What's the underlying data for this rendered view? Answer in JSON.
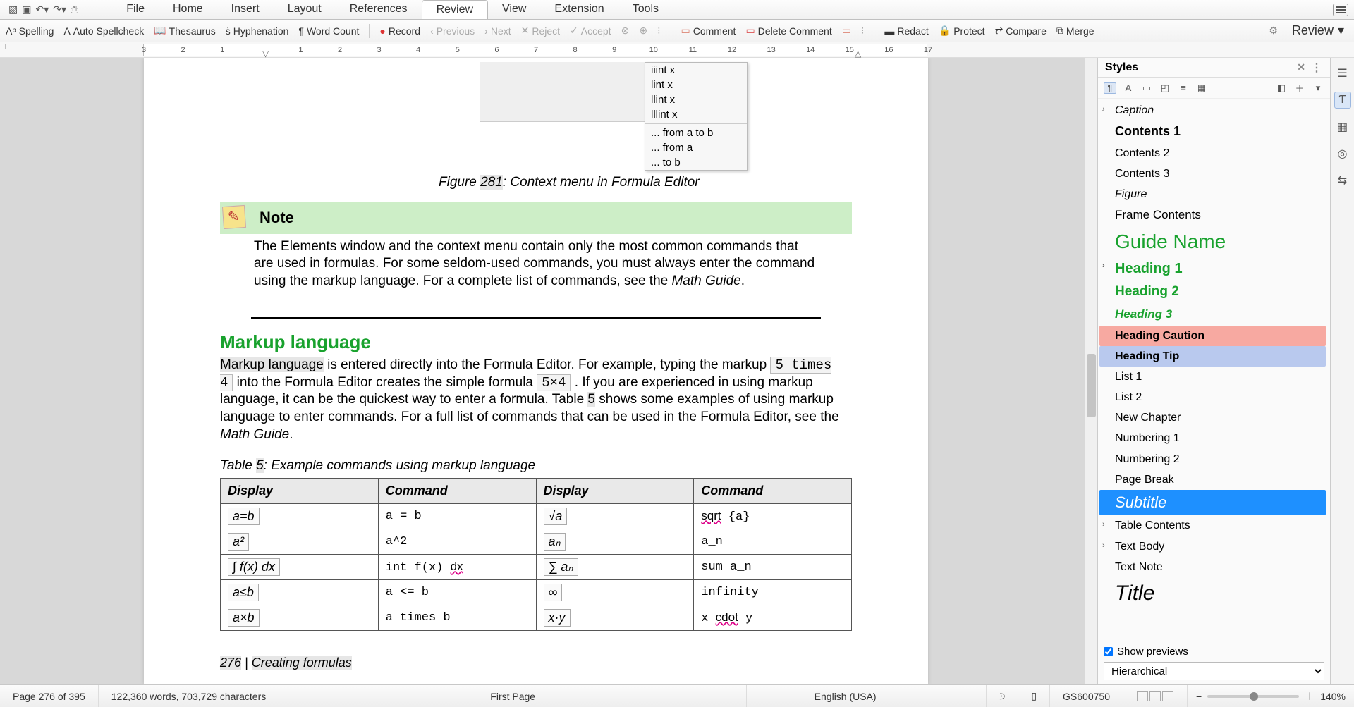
{
  "menu": {
    "tabs": [
      "File",
      "Home",
      "Insert",
      "Layout",
      "References",
      "Review",
      "View",
      "Extension",
      "Tools"
    ],
    "active": "Review"
  },
  "toolbar": {
    "spelling": "Spelling",
    "autospell": "Auto Spellcheck",
    "thesaurus": "Thesaurus",
    "hyphen": "Hyphenation",
    "wordcount": "Word Count",
    "record": "Record",
    "previous": "Previous",
    "next": "Next",
    "reject": "Reject",
    "accept": "Accept",
    "comment": "Comment",
    "delcomment": "Delete Comment",
    "redact": "Redact",
    "protect": "Protect",
    "compare": "Compare",
    "merge": "Merge",
    "review_big": "Review"
  },
  "ruler": {
    "nums": [
      "3",
      "2",
      "1",
      "",
      "1",
      "2",
      "3",
      "4",
      "5",
      "6",
      "7",
      "8",
      "9",
      "10",
      "11",
      "12",
      "13",
      "14",
      "15",
      "16",
      "17"
    ]
  },
  "ctx_menu": {
    "items": [
      "iiint x",
      "lint x",
      "llint x",
      "lllint x"
    ],
    "items2": [
      "... from a to b",
      "... from a",
      "... to b"
    ]
  },
  "caption": {
    "pre": "Figure ",
    "num": "281",
    "post": ": Context menu in Formula Editor"
  },
  "note": {
    "title": "Note",
    "body_a": "The Elements window and the context menu contain only the most common commands that are used in formulas. For some seldom-used commands, you must always enter the command using the markup language. For a complete list of commands, see the ",
    "body_em": "Math Guide",
    "body_b": "."
  },
  "heading": "Markup language",
  "para": {
    "hl": "Markup language",
    "a": " is entered directly into the Formula Editor. For example, typing the markup ",
    "code1": "5 times 4",
    "b": " into the Formula Editor creates the simple formula ",
    "code2": "5×4",
    "c": " . If you are experienced in using markup language, it can be the quickest way to enter a formula. Table ",
    "tnum": "5",
    "d": " shows some examples of using markup language to enter commands. For a full list of commands that can be used in the Formula Editor, see the ",
    "em": "Math Guide",
    "e": "."
  },
  "tcaption": {
    "pre": "Table ",
    "num": "5",
    "post": ": Example commands using markup language"
  },
  "table": {
    "headers": [
      "Display",
      "Command",
      "Display",
      "Command"
    ],
    "rows": [
      {
        "d1": "a=b",
        "c1": "a = b",
        "d2": "√a",
        "c2": "sqrt {a}",
        "c2wavy": true
      },
      {
        "d1": "a²",
        "c1": "a^2",
        "d2": "aₙ",
        "c2": "a_n"
      },
      {
        "d1": "∫ f(x) dx",
        "c1": "int f(x) dx",
        "c1wavy": "dx",
        "d2": "∑ aₙ",
        "c2": "sum a_n"
      },
      {
        "d1": "a≤b",
        "c1": "a <= b",
        "d2": "∞",
        "c2": "infinity"
      },
      {
        "d1": "a×b",
        "c1": "a times b",
        "d2": "x·y",
        "c2": "x cdot y",
        "c2wavy_part": "cdot"
      }
    ]
  },
  "footer": {
    "num": "276",
    "sep": " | ",
    "title": "Creating formulas"
  },
  "sidebar": {
    "title": "Styles",
    "items": [
      {
        "label": "Caption",
        "cls": "st-caption",
        "chev": true
      },
      {
        "label": "Contents 1",
        "cls": "st-contents1"
      },
      {
        "label": "Contents 2",
        "cls": ""
      },
      {
        "label": "Contents 3",
        "cls": ""
      },
      {
        "label": "Figure",
        "cls": "st-figure"
      },
      {
        "label": "Frame Contents",
        "cls": "st-frame"
      },
      {
        "label": "Guide Name",
        "cls": "st-guide"
      },
      {
        "label": "Heading 1",
        "cls": "st-h1",
        "chev": true
      },
      {
        "label": "Heading 2",
        "cls": "st-h2"
      },
      {
        "label": "Heading 3",
        "cls": "st-h3"
      },
      {
        "label": "Heading Caution",
        "cls": "st-caution"
      },
      {
        "label": "Heading Tip",
        "cls": "st-tip"
      },
      {
        "label": "List 1",
        "cls": ""
      },
      {
        "label": "List 2",
        "cls": ""
      },
      {
        "label": "New Chapter",
        "cls": ""
      },
      {
        "label": "Numbering 1",
        "cls": ""
      },
      {
        "label": "Numbering 2",
        "cls": ""
      },
      {
        "label": "Page Break",
        "cls": "st-pgbrk"
      },
      {
        "label": "Subtitle",
        "cls": "st-subtitle"
      },
      {
        "label": "Table Contents",
        "cls": "",
        "chev": true
      },
      {
        "label": "Text Body",
        "cls": "",
        "chev": true
      },
      {
        "label": "Text Note",
        "cls": ""
      },
      {
        "label": "Title",
        "cls": "st-title"
      }
    ],
    "show_previews": "Show previews",
    "filter": "Hierarchical"
  },
  "status": {
    "page": "Page 276 of 395",
    "counts": "122,360 words, 703,729 characters",
    "style": "First Page",
    "lang": "English (USA)",
    "doc": "GS600750",
    "zoom": "140%"
  }
}
